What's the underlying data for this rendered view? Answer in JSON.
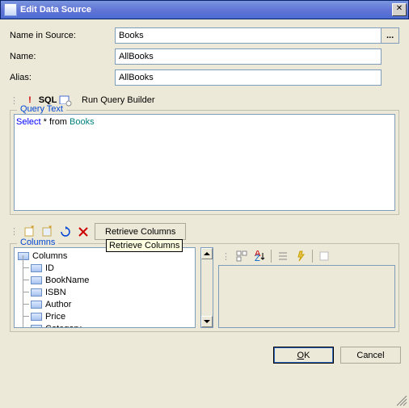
{
  "window": {
    "title": "Edit Data Source"
  },
  "form": {
    "nameInSource": {
      "label": "Name in Source:",
      "value": "Books"
    },
    "name": {
      "label": "Name:",
      "value": "AllBooks"
    },
    "alias": {
      "label": "Alias:",
      "value": "AllBooks"
    }
  },
  "queryToolbar": {
    "sqlText": "SQL",
    "runBuilder": "Run Query Builder"
  },
  "queryText": {
    "legend": "Query Text",
    "kw": "Select",
    "mid": " * from ",
    "tbl": "Books"
  },
  "colsToolbar": {
    "retrieve": "Retrieve Columns",
    "tooltip": "Retrieve Columns"
  },
  "columns": {
    "legend": "Columns",
    "root": "Columns",
    "items": [
      "ID",
      "BookName",
      "ISBN",
      "Author",
      "Price",
      "Category"
    ]
  },
  "buttons": {
    "ok": "OK",
    "cancel": "Cancel"
  }
}
